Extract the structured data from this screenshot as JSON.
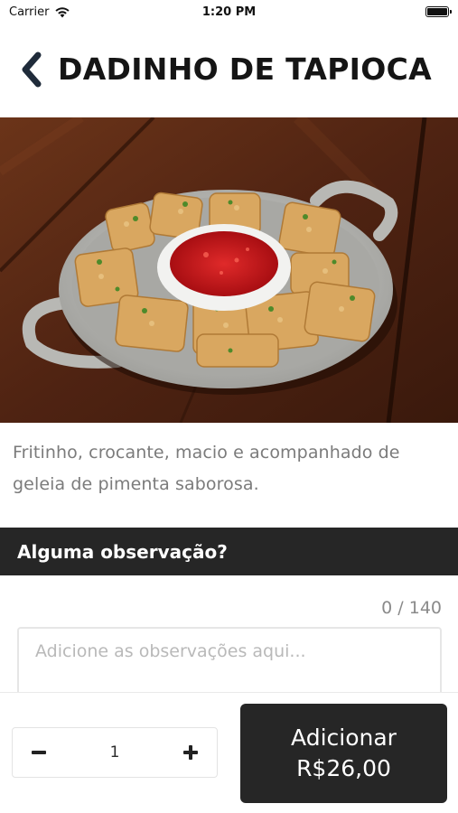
{
  "status_bar": {
    "carrier": "Carrier",
    "time": "1:20 PM"
  },
  "header": {
    "title": "DADINHO DE TAPIOCA",
    "back_icon": "chevron-left-icon"
  },
  "product": {
    "description": "Fritinho, crocante, macio e acompanhado de geleia de pimenta saborosa."
  },
  "observations": {
    "section_title": "Alguma observação?",
    "char_count": "0 / 140",
    "placeholder": "Adicione as observações aqui...",
    "value": ""
  },
  "footer": {
    "quantity": "1",
    "decrement_icon": "minus-icon",
    "increment_icon": "plus-icon",
    "add_label": "Adicionar",
    "add_price": "R$26,00"
  },
  "colors": {
    "dark": "#262626",
    "text_muted": "#7b7b7b",
    "border": "#e6e6e6"
  }
}
